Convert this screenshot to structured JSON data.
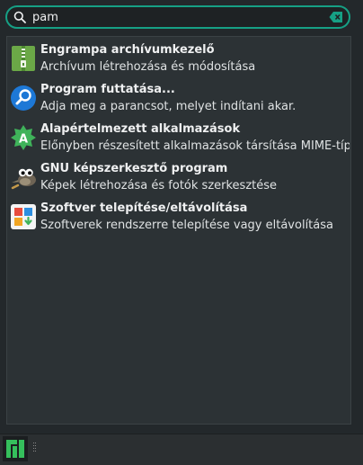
{
  "search": {
    "value": "pam",
    "icon": "search-icon",
    "clear_icon": "clear-text-icon"
  },
  "results": [
    {
      "title": "Engrampa archívumkezelő",
      "description": "Archívum létrehozása és módosítása",
      "icon": "archive-manager-icon"
    },
    {
      "title": "Program futtatása...",
      "description": "Adja meg a parancsot, melyet indítani akar.",
      "icon": "run-program-icon"
    },
    {
      "title": "Alapértelmezett alkalmazások",
      "description": "Előnyben részesített alkalmazások társítása MIME-típu…",
      "icon": "default-applications-icon"
    },
    {
      "title": "GNU képszerkesztő program",
      "description": "Képek létrehozása és fotók szerkesztése",
      "icon": "gimp-icon"
    },
    {
      "title": "Szoftver telepítése/eltávolítása",
      "description": "Szoftverek rendszerre telepítése vagy eltávolítása",
      "icon": "software-manager-icon"
    }
  ],
  "taskbar": {
    "launcher_icon": "manjaro-logo-icon"
  },
  "colors": {
    "accent": "#16a085",
    "background": "#2b2f31",
    "list_background": "#2c3235",
    "text": "#eff0f1"
  }
}
